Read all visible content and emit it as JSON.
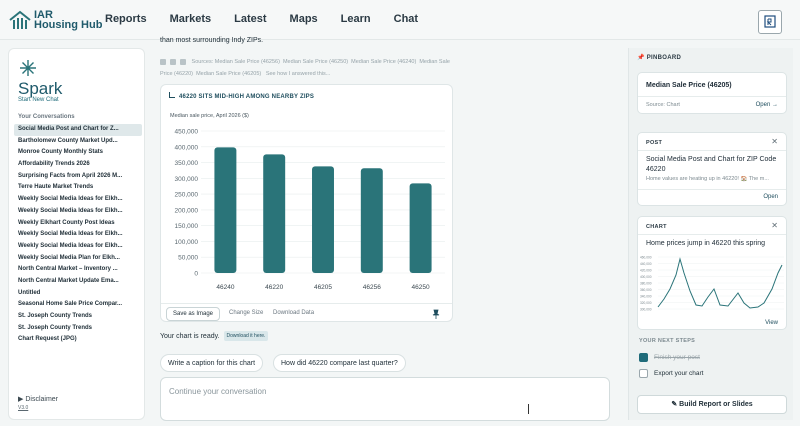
{
  "app": {
    "logo_line1": "IAR",
    "logo_line2": "Housing Hub"
  },
  "nav": [
    {
      "label": "Reports"
    },
    {
      "label": "Markets"
    },
    {
      "label": "Latest"
    },
    {
      "label": "Maps"
    },
    {
      "label": "Learn"
    },
    {
      "label": "Chat"
    }
  ],
  "sidebar": {
    "title": "Spark",
    "new_chat": "Start New Chat",
    "section_label": "Your Conversations",
    "conversations": [
      {
        "label": "Social Media Post and Chart for Z..."
      },
      {
        "label": "Bartholomew County Market Upd..."
      },
      {
        "label": "Monroe County Monthly Stats"
      },
      {
        "label": "Affordability Trends 2026"
      },
      {
        "label": "Surprising Facts from April 2026 M..."
      },
      {
        "label": "Terre Haute Market Trends"
      },
      {
        "label": "Weekly Social Media Ideas for Elkh..."
      },
      {
        "label": "Weekly Social Media Ideas for Elkh..."
      },
      {
        "label": "Weekly Elkhart County Post Ideas"
      },
      {
        "label": "Weekly Social Media Ideas for Elkh..."
      },
      {
        "label": "Weekly Social Media Ideas for Elkh..."
      },
      {
        "label": "Weekly Social Media Plan for Elkh..."
      },
      {
        "label": "North Central Market – Inventory ..."
      },
      {
        "label": "North Central Market Update Ema..."
      },
      {
        "label": "Untitled"
      },
      {
        "label": "Seasonal Home Sale Price Compar..."
      },
      {
        "label": "St. Joseph County Trends"
      },
      {
        "label": "St. Joseph County Trends"
      },
      {
        "label": "Chart Request (JPG)"
      }
    ],
    "disclaimer": "Disclaimer",
    "version": "V3.0"
  },
  "main": {
    "intro": "than most surrounding Indy ZIPs.",
    "sources_label": "Sources:",
    "sources": [
      "Median Sale Price (46256)",
      "Median Sale Price (46250)",
      "Median Sale Price (46240)",
      "Median Sale Price (46220)",
      "Median Sale Price (46205)"
    ],
    "see_how": "See how I answered this...",
    "ready_text": "Your chart is ready.",
    "download_chip": "Download it here.",
    "suggestions": [
      "Write a caption for this chart",
      "How did 46220 compare last quarter?"
    ],
    "composer_placeholder": "Continue your conversation"
  },
  "chart_card": {
    "header": "46220 SITS MID-HIGH AMONG NEARBY ZIPS",
    "actions": {
      "save": "Save as Image",
      "change_size": "Change Size",
      "download": "Download Data"
    }
  },
  "chart_data": {
    "type": "bar",
    "title": "46220 SITS MID-HIGH AMONG NEARBY ZIPS",
    "subtitle": "Median sale price, April 2026 ($)",
    "categories": [
      "46240",
      "46220",
      "46205",
      "46256",
      "46250"
    ],
    "values": [
      398000,
      376000,
      338000,
      332000,
      284000
    ],
    "ylim": [
      0,
      450000
    ],
    "yticks": [
      0,
      50000,
      100000,
      150000,
      200000,
      250000,
      300000,
      350000,
      400000,
      450000
    ],
    "ytick_labels": [
      "0",
      "50,000",
      "100,000",
      "150,000",
      "200,000",
      "250,000",
      "300,000",
      "350,000",
      "400,000",
      "450,000"
    ],
    "grid": true,
    "bar_color": "#2a7479"
  },
  "pinboard": {
    "title": "PINBOARD",
    "cards": {
      "price": {
        "title": "Median Sale Price (46205)",
        "meta": "Source: Chart",
        "link": "Open →"
      },
      "post": {
        "label": "POST",
        "title": "Social Media Post and Chart for ZIP Code 46220",
        "meta": "Home values are heating up in 46220! 🏠 The m...",
        "link": "Open"
      },
      "chart": {
        "label": "CHART",
        "title": "Home prices jump in 46220 this spring",
        "link": "View",
        "mini_yticks": [
          "460,000",
          "440,000",
          "420,000",
          "400,000",
          "380,000",
          "360,000",
          "340,000",
          "320,000",
          "300,000"
        ]
      }
    },
    "next_steps_label": "YOUR NEXT STEPS",
    "steps": [
      {
        "label": "Finish your post",
        "done": true
      },
      {
        "label": "Export your chart",
        "done": false
      }
    ],
    "build_button": "Build Report or Slides"
  },
  "colors": {
    "brand": "#1f5a6b",
    "bar": "#2a7479",
    "accent": "#1f6b7a"
  }
}
